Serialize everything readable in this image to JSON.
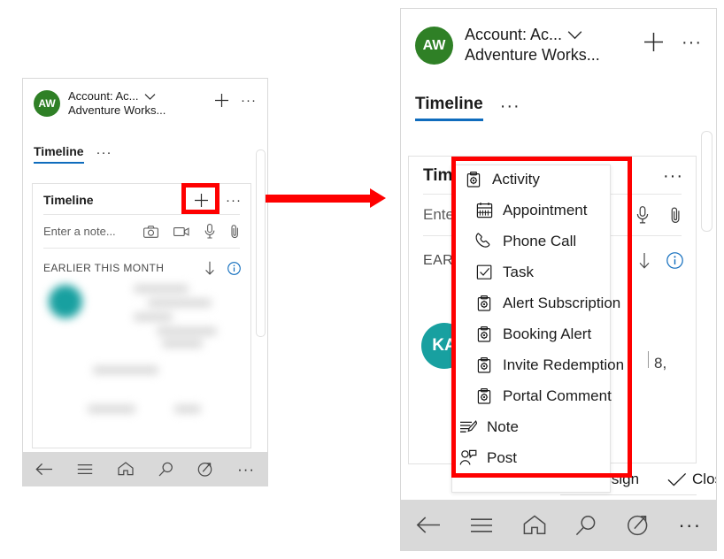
{
  "theme": {
    "accent_blue": "#0f6cbd",
    "avatar_green": "#2f8026",
    "avatar_teal": "#18a0a0",
    "highlight_red": "#fe0000",
    "navbar_gray": "#d9d9d9"
  },
  "left_phone": {
    "header": {
      "avatar_initials": "AW",
      "account_line1": "Account: Ac...",
      "account_line2": "Adventure Works...",
      "chevron_icon": "chevron-down-icon",
      "add_icon": "plus-icon",
      "overflow_icon": "ellipsis-icon",
      "overflow_label": "···"
    },
    "tab": {
      "label": "Timeline",
      "overflow_label": "···"
    },
    "card": {
      "title": "Timeline",
      "add_icon": "plus-icon",
      "add_label": "+",
      "overflow_label": "···",
      "note_placeholder": "Enter a note...",
      "note_icons": [
        "camera-icon",
        "video-icon",
        "microphone-icon",
        "attachment-icon"
      ],
      "section_label": "EARLIER THIS MONTH",
      "sort_icon": "arrow-down-icon",
      "info_icon": "info-icon"
    },
    "navbar": {
      "items": [
        "back-icon",
        "menu-icon",
        "home-icon",
        "search-icon",
        "compass-icon",
        "more-icon"
      ],
      "more_label": "···"
    }
  },
  "right_phone": {
    "header": {
      "avatar_initials": "AW",
      "account_line1": "Account: Ac...",
      "account_line2": "Adventure Works...",
      "chevron_icon": "chevron-down-icon",
      "add_icon": "plus-icon",
      "overflow_label": "···"
    },
    "tab": {
      "label": "Timeline",
      "overflow_label": "···"
    },
    "card": {
      "title_clipped": "Tim",
      "overflow_label": "···",
      "note_placeholder_clipped": "Ente",
      "note_icons": [
        "microphone-icon",
        "attachment-icon"
      ],
      "section_label_clipped": "EAR",
      "info_icon": "info-icon",
      "avatar_initials_clipped": "KA",
      "date_fragment": "8,"
    },
    "menu": {
      "items": [
        {
          "label": "Activity",
          "icon": "activity-icon"
        },
        {
          "label": "Appointment",
          "icon": "calendar-icon"
        },
        {
          "label": "Phone Call",
          "icon": "phone-icon"
        },
        {
          "label": "Task",
          "icon": "task-checkbox-icon"
        },
        {
          "label": "Alert Subscription",
          "icon": "activity-icon"
        },
        {
          "label": "Booking Alert",
          "icon": "activity-icon"
        },
        {
          "label": "Invite Redemption",
          "icon": "activity-icon"
        },
        {
          "label": "Portal Comment",
          "icon": "activity-icon"
        },
        {
          "label": "Note",
          "icon": "note-icon"
        },
        {
          "label": "Post",
          "icon": "post-icon"
        }
      ]
    },
    "command_bar": {
      "assign": {
        "label": "Assign",
        "icon": "assign-person-icon"
      },
      "close": {
        "label": "Close",
        "icon": "check-icon"
      },
      "overflow_label": "···"
    },
    "navbar": {
      "items": [
        "back-icon",
        "menu-icon",
        "home-icon",
        "search-icon",
        "compass-icon",
        "more-icon"
      ],
      "more_label": "···"
    }
  },
  "annotations": {
    "flow_arrow_icon": "right-arrow-icon",
    "highlight_plus_button": "red-highlight-box",
    "highlight_menu": "red-highlight-box"
  }
}
